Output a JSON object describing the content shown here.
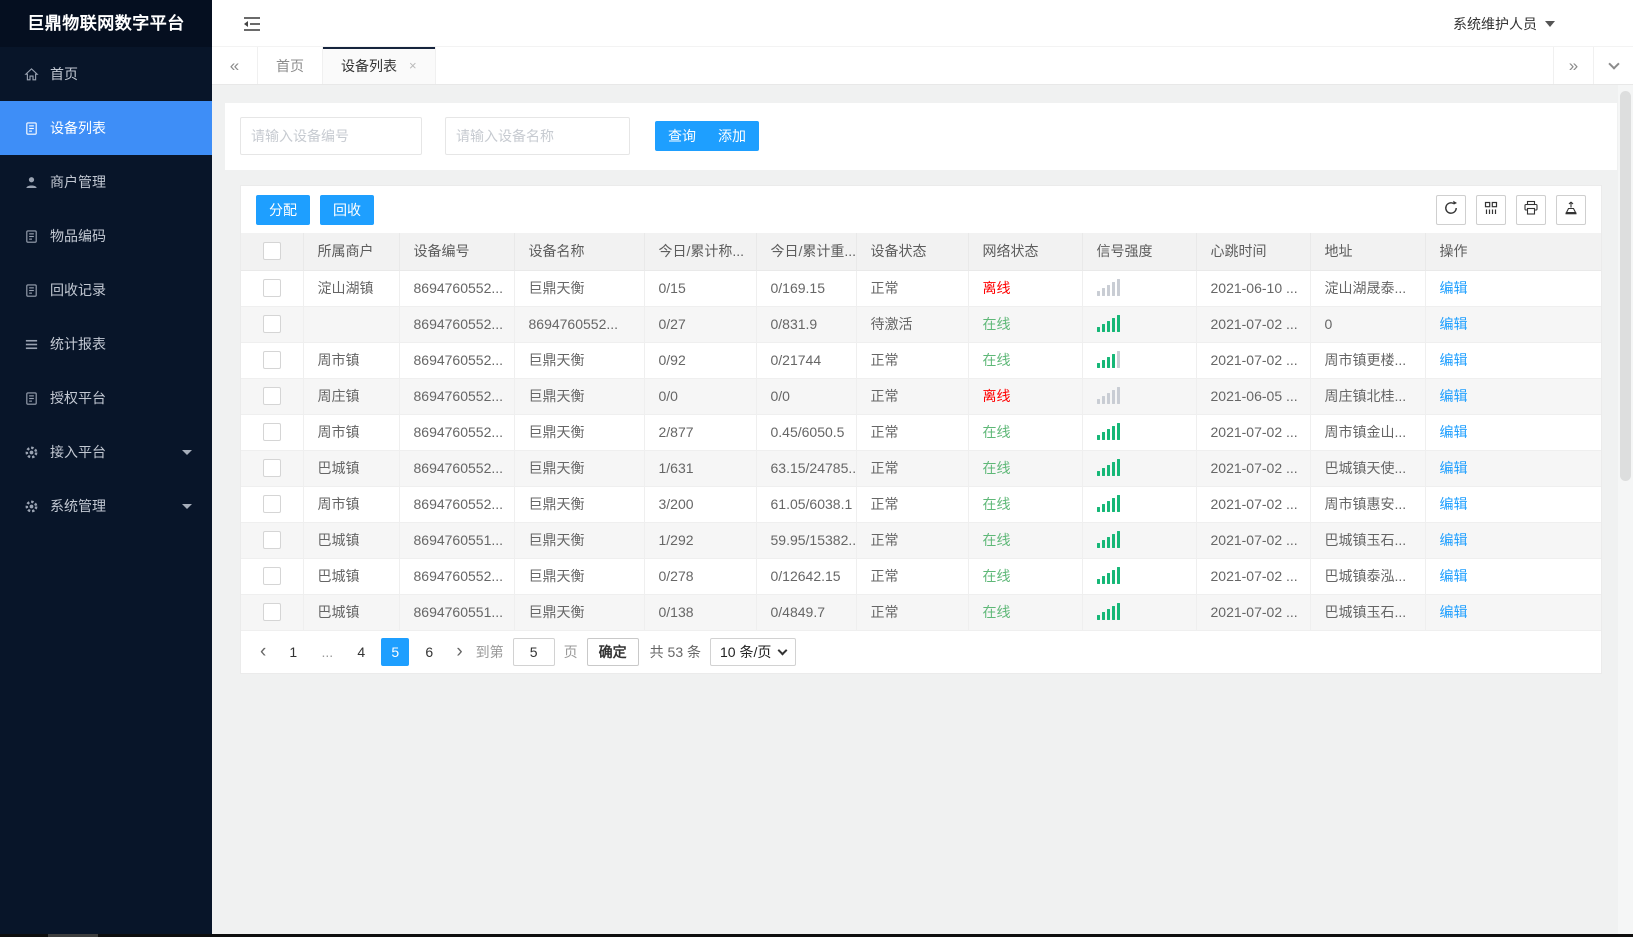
{
  "app": {
    "logo_title": "巨鼎物联网数字平台",
    "user_name": "系统维护人员"
  },
  "sidebar": {
    "items": [
      {
        "label": "首页",
        "icon": "home",
        "active": false,
        "has_submenu": false
      },
      {
        "label": "设备列表",
        "icon": "clipboard",
        "active": true,
        "has_submenu": false
      },
      {
        "label": "商户管理",
        "icon": "user",
        "active": false,
        "has_submenu": false
      },
      {
        "label": "物品编码",
        "icon": "clipboard",
        "active": false,
        "has_submenu": false
      },
      {
        "label": "回收记录",
        "icon": "clipboard",
        "active": false,
        "has_submenu": false
      },
      {
        "label": "统计报表",
        "icon": "list",
        "active": false,
        "has_submenu": false
      },
      {
        "label": "授权平台",
        "icon": "clipboard",
        "active": false,
        "has_submenu": false
      },
      {
        "label": "接入平台",
        "icon": "gear",
        "active": false,
        "has_submenu": true
      },
      {
        "label": "系统管理",
        "icon": "gear",
        "active": false,
        "has_submenu": true
      }
    ]
  },
  "tabbar": {
    "tabs": [
      {
        "label": "首页",
        "active": false,
        "closable": false
      },
      {
        "label": "设备列表",
        "active": true,
        "closable": true
      }
    ]
  },
  "search": {
    "device_no_placeholder": "请输入设备编号",
    "device_name_placeholder": "请输入设备名称",
    "query_label": "查询",
    "add_label": "添加"
  },
  "toolbar": {
    "assign_label": "分配",
    "recycle_label": "回收",
    "icons": [
      "refresh",
      "columns",
      "print",
      "export"
    ]
  },
  "table": {
    "columns": [
      "所属商户",
      "设备编号",
      "设备名称",
      "今日/累计称...",
      "今日/累计重...",
      "设备状态",
      "网络状态",
      "信号强度",
      "心跳时间",
      "地址",
      "操作"
    ],
    "rows": [
      {
        "merchant": "淀山湖镇",
        "device_no": "8694760552...",
        "device_name": "巨鼎天衡",
        "today_total_count": "0/15",
        "today_total_weight": "0/169.15",
        "device_status": "正常",
        "network_status": "离线",
        "online": false,
        "signal_level": 0,
        "heartbeat": "2021-06-10 ...",
        "address": "淀山湖晟泰...",
        "action": "编辑"
      },
      {
        "merchant": "",
        "device_no": "8694760552...",
        "device_name": "8694760552...",
        "today_total_count": "0/27",
        "today_total_weight": "0/831.9",
        "device_status": "待激活",
        "network_status": "在线",
        "online": true,
        "signal_level": 5,
        "heartbeat": "2021-07-02 ...",
        "address": "0",
        "action": "编辑"
      },
      {
        "merchant": "周市镇",
        "device_no": "8694760552...",
        "device_name": "巨鼎天衡",
        "today_total_count": "0/92",
        "today_total_weight": "0/21744",
        "device_status": "正常",
        "network_status": "在线",
        "online": true,
        "signal_level": 4,
        "heartbeat": "2021-07-02 ...",
        "address": "周市镇更楼...",
        "action": "编辑"
      },
      {
        "merchant": "周庄镇",
        "device_no": "8694760552...",
        "device_name": "巨鼎天衡",
        "today_total_count": "0/0",
        "today_total_weight": "0/0",
        "device_status": "正常",
        "network_status": "离线",
        "online": false,
        "signal_level": 0,
        "heartbeat": "2021-06-05 ...",
        "address": "周庄镇北桂...",
        "action": "编辑"
      },
      {
        "merchant": "周市镇",
        "device_no": "8694760552...",
        "device_name": "巨鼎天衡",
        "today_total_count": "2/877",
        "today_total_weight": "0.45/6050.5",
        "device_status": "正常",
        "network_status": "在线",
        "online": true,
        "signal_level": 5,
        "heartbeat": "2021-07-02 ...",
        "address": "周市镇金山...",
        "action": "编辑"
      },
      {
        "merchant": "巴城镇",
        "device_no": "8694760552...",
        "device_name": "巨鼎天衡",
        "today_total_count": "1/631",
        "today_total_weight": "63.15/24785...",
        "device_status": "正常",
        "network_status": "在线",
        "online": true,
        "signal_level": 5,
        "heartbeat": "2021-07-02 ...",
        "address": "巴城镇天使...",
        "action": "编辑"
      },
      {
        "merchant": "周市镇",
        "device_no": "8694760552...",
        "device_name": "巨鼎天衡",
        "today_total_count": "3/200",
        "today_total_weight": "61.05/6038.1",
        "device_status": "正常",
        "network_status": "在线",
        "online": true,
        "signal_level": 5,
        "heartbeat": "2021-07-02 ...",
        "address": "周市镇惠安...",
        "action": "编辑"
      },
      {
        "merchant": "巴城镇",
        "device_no": "8694760551...",
        "device_name": "巨鼎天衡",
        "today_total_count": "1/292",
        "today_total_weight": "59.95/15382...",
        "device_status": "正常",
        "network_status": "在线",
        "online": true,
        "signal_level": 5,
        "heartbeat": "2021-07-02 ...",
        "address": "巴城镇玉石...",
        "action": "编辑"
      },
      {
        "merchant": "巴城镇",
        "device_no": "8694760552...",
        "device_name": "巨鼎天衡",
        "today_total_count": "0/278",
        "today_total_weight": "0/12642.15",
        "device_status": "正常",
        "network_status": "在线",
        "online": true,
        "signal_level": 5,
        "heartbeat": "2021-07-02 ...",
        "address": "巴城镇泰泓...",
        "action": "编辑"
      },
      {
        "merchant": "巴城镇",
        "device_no": "8694760551...",
        "device_name": "巨鼎天衡",
        "today_total_count": "0/138",
        "today_total_weight": "0/4849.7",
        "device_status": "正常",
        "network_status": "在线",
        "online": true,
        "signal_level": 5,
        "heartbeat": "2021-07-02 ...",
        "address": "巴城镇玉石...",
        "action": "编辑"
      }
    ]
  },
  "pagination": {
    "pages": [
      "1",
      "...",
      "4",
      "5",
      "6"
    ],
    "active_page": "5",
    "goto_label": "到第",
    "goto_value": "5",
    "page_unit_label": "页",
    "confirm_label": "确定",
    "total_label": "共 53 条",
    "page_size_label": "10 条/页"
  },
  "colors": {
    "accent_blue": "#1e9fff",
    "sidebar_active_blue": "#3e8ef7",
    "online_green": "#5fb878",
    "offline_red": "#ff0000",
    "signal_green": "#16b777",
    "signal_gray": "#c9cdd4",
    "sidebar_bg": "#081529"
  }
}
